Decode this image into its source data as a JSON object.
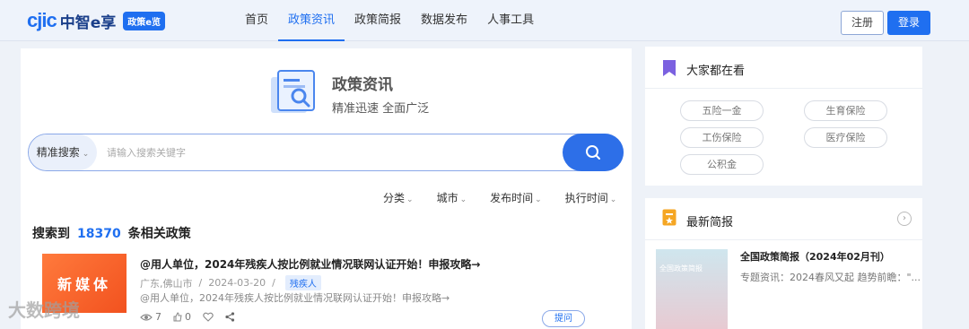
{
  "brand": {
    "logo_text": "cjic",
    "logo_name": "中智e享",
    "badge": "政策e览"
  },
  "nav": [
    {
      "label": "首页"
    },
    {
      "label": "政策资讯"
    },
    {
      "label": "政策简报"
    },
    {
      "label": "数据发布"
    },
    {
      "label": "人事工具"
    }
  ],
  "nav_active_index": 1,
  "auth": {
    "register": "注册",
    "login": "登录"
  },
  "hero": {
    "title": "政策资讯",
    "subtitle": "精准迅速 全面广泛"
  },
  "search": {
    "type_label": "精准搜索",
    "placeholder": "请输入搜索关键字"
  },
  "filters": [
    {
      "label": "分类"
    },
    {
      "label": "城市"
    },
    {
      "label": "发布时间"
    },
    {
      "label": "执行时间"
    }
  ],
  "results": {
    "prefix": "搜索到",
    "count": "18370",
    "suffix": "条相关政策"
  },
  "article": {
    "thumb_text": "新媒体",
    "title": "@用人单位，2024年残疾人按比例就业情况联网认证开始！申报攻略→",
    "location": "广东,佛山市",
    "date": "2024-03-20",
    "tag": "残疾人",
    "summary": "@用人单位，2024年残疾人按比例就业情况联网认证开始！申报攻略→",
    "views": "7",
    "likes": "0",
    "ask_label": "提问"
  },
  "watermark": "大数跨境",
  "popular": {
    "title": "大家都在看",
    "chips": [
      {
        "label": "五险一金"
      },
      {
        "label": "生育保险"
      },
      {
        "label": "工伤保险"
      },
      {
        "label": "医疗保险"
      },
      {
        "label": "公积金"
      }
    ]
  },
  "briefs": {
    "title": "最新简报",
    "item": {
      "thumb_text": "全国政策简报",
      "title": "全国政策简报（2024年02月刊）",
      "desc": "专题资讯：2024春风又起 趋势前瞻：\"..."
    }
  },
  "colors": {
    "brand": "#1f6ff0",
    "accent_orange": "#f2521f",
    "sidebar_icon": "#7b61e0",
    "brief_icon": "#f5a623"
  }
}
